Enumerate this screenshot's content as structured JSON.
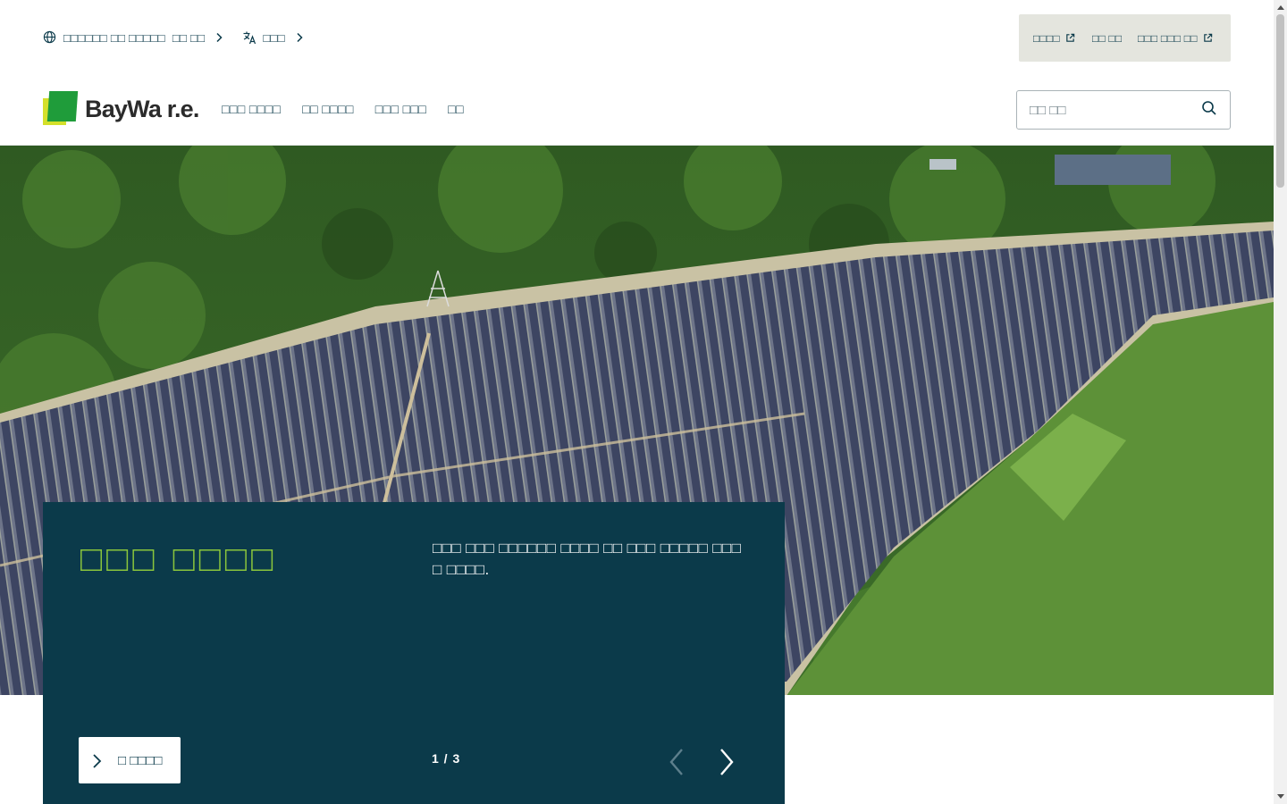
{
  "utility": {
    "region_label": "□□□□□□ □□ □□□□□",
    "region_value": "□□ □□",
    "language_label": "□□□"
  },
  "quick_links": [
    {
      "label": "□□□□",
      "external": true
    },
    {
      "label": "□□ □□",
      "external": false
    },
    {
      "label": "□□□ □□□ □□",
      "external": true
    }
  ],
  "logo": {
    "text": "BayWa r.e."
  },
  "nav": {
    "items": [
      {
        "label": "□□□ □□□□"
      },
      {
        "label": "□□ □□□□"
      },
      {
        "label": "□□□ □□□"
      },
      {
        "label": "□□"
      }
    ]
  },
  "search": {
    "placeholder": "□□ □□"
  },
  "hero": {
    "title": "□□□ □□□□",
    "description": "□□□ □□□ □□□□□□ □□□□ □□ □□□ □□□□□ □□□ □ □□□□.",
    "more_label": "□ □□□□",
    "pager": "1 / 3",
    "current_slide": 1,
    "total_slides": 3
  },
  "colors": {
    "brand_dark": "#0b3a4a",
    "brand_green": "#8ac53c",
    "logo_green": "#1f9c3a",
    "logo_yellow": "#d4e02a",
    "quick_links_bg": "#e4e5de"
  },
  "icons": {
    "globe": "globe-icon",
    "translate": "translate-icon",
    "chevron": "chevron-right-icon",
    "external": "external-link-icon",
    "search": "search-icon",
    "prev": "arrow-left-icon",
    "next": "arrow-right-icon"
  }
}
